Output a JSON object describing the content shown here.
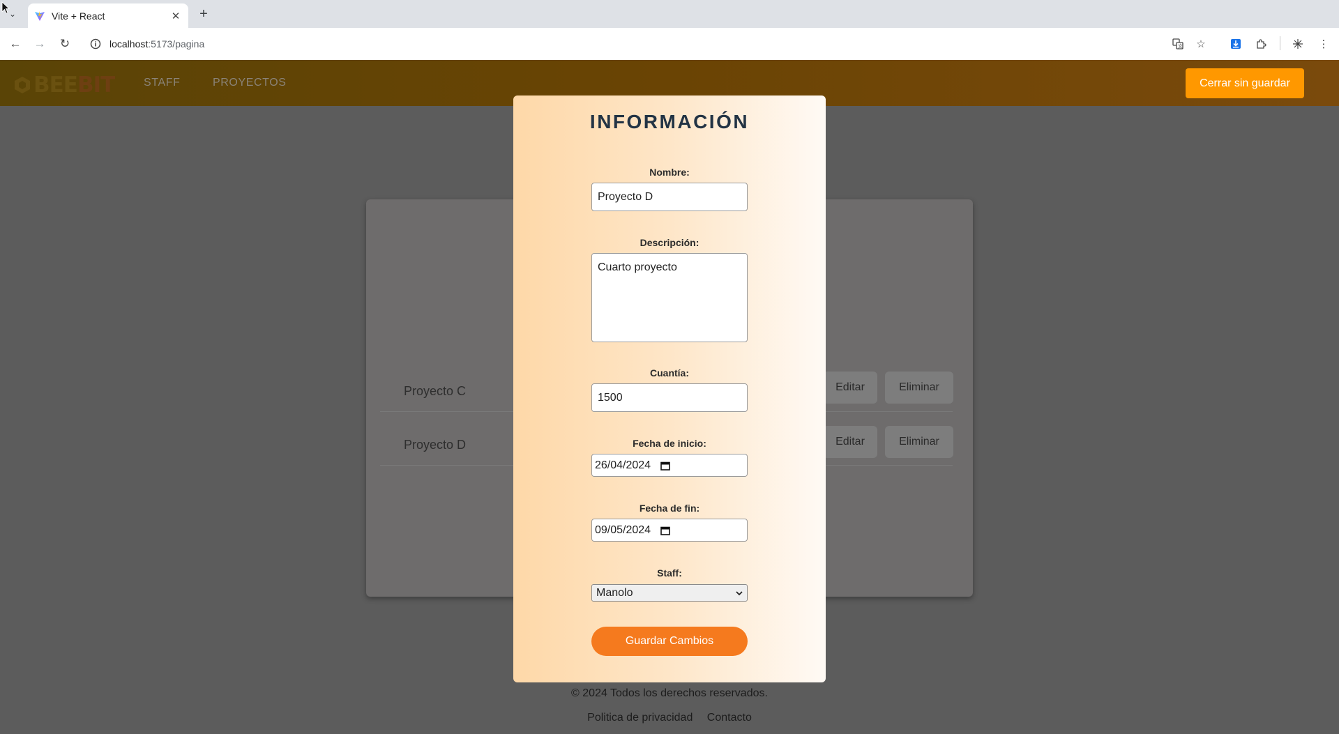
{
  "browser": {
    "tab_title": "Vite + React",
    "url_host": "localhost",
    "url_path": ":5173/pagina"
  },
  "header": {
    "logo_text_left": "BEE",
    "logo_text_right": "BIT",
    "nav": [
      "STAFF",
      "PROYECTOS"
    ],
    "close_button": "Cerrar sin guardar",
    "accent_color": "#ff9800"
  },
  "projects": [
    {
      "name": "Proyecto C",
      "edit": "Editar",
      "delete": "Eliminar"
    },
    {
      "name": "Proyecto D",
      "edit": "Editar",
      "delete": "Eliminar"
    }
  ],
  "modal": {
    "title": "INFORMACIÓN",
    "nombre_label": "Nombre:",
    "nombre_value": "Proyecto D",
    "descripcion_label": "Descripción:",
    "descripcion_value": "Cuarto proyecto",
    "cuantia_label": "Cuantía:",
    "cuantia_value": "1500",
    "fecha_inicio_label": "Fecha de inicio:",
    "fecha_inicio_value": "26/04/2024",
    "fecha_fin_label": "Fecha de fin:",
    "fecha_fin_value": "09/05/2024",
    "staff_label": "Staff:",
    "staff_value": "Manolo",
    "save_button": "Guardar Cambios",
    "save_color": "#f57a1e"
  },
  "footer": {
    "copyright": "© 2024 Todos los derechos reservados.",
    "links": [
      "Politica de privacidad",
      "Contacto"
    ]
  }
}
